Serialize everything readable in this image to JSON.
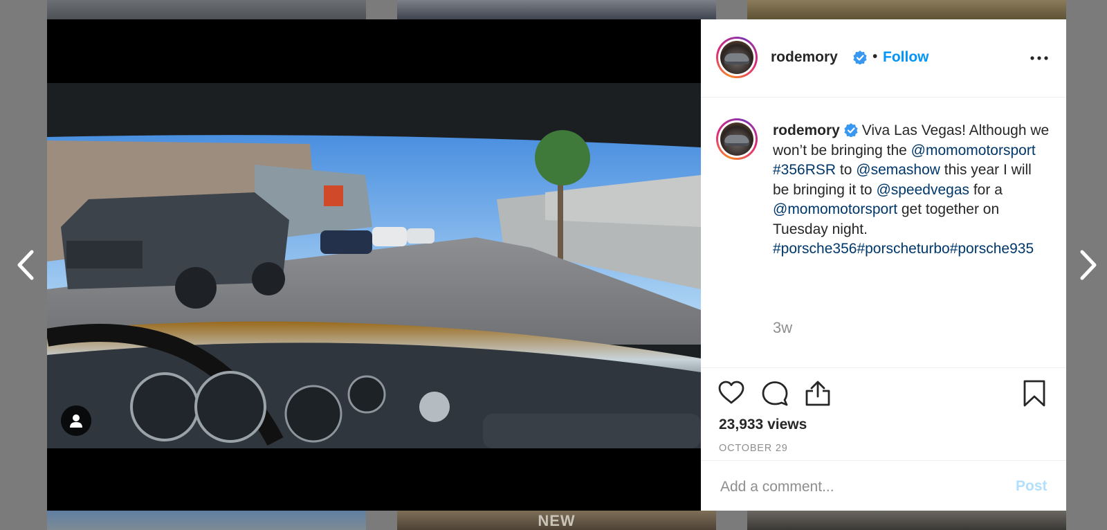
{
  "background": {
    "bottom_middle_thumb_label": "NEW"
  },
  "header": {
    "username": "rodemory",
    "separator": "•",
    "follow_label": "Follow",
    "verified_icon": "verified-badge-icon",
    "more_icon": "more-options-icon"
  },
  "caption": {
    "username": "rodemory",
    "text_1": " Viva Las Vegas! Although we won’t be bringing the ",
    "mention_1": "@momomotorsport",
    "hashtag_1": "#356RSR",
    "text_2": " to ",
    "mention_2": "@semashow",
    "text_3": " this year I will be bringing it to ",
    "mention_3": "@speedvegas",
    "text_4": " for a ",
    "mention_4": "@momomotorsport",
    "text_5": " get together on Tuesday night. ",
    "hashtag_2": "#porsche356",
    "hashtag_3": "#porscheturbo",
    "hashtag_4": "#porsche935",
    "relative_time": "3w"
  },
  "actions": {
    "like_icon": "heart-icon",
    "comment_icon": "comment-icon",
    "share_icon": "share-icon",
    "save_icon": "bookmark-icon",
    "views": "23,933 views",
    "date": "OCTOBER 29"
  },
  "comment": {
    "placeholder": "Add a comment...",
    "post_label": "Post"
  },
  "colors": {
    "link": "#00376b",
    "follow": "#0095f6",
    "post_disabled": "#b2dffc",
    "verified": "#3897f0"
  }
}
